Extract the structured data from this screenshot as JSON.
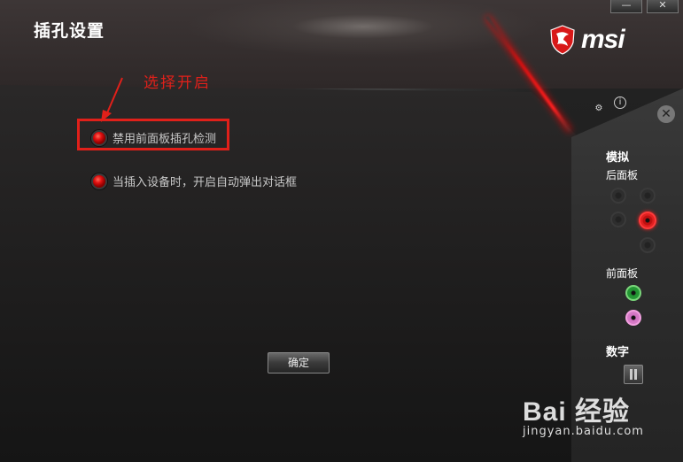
{
  "window": {
    "title": "插孔设置",
    "minimize_label": "—",
    "close_label": "✕"
  },
  "brand": {
    "logo_text": "msi"
  },
  "annotation": {
    "text": "选择开启",
    "color": "#e0201a"
  },
  "options": [
    {
      "label": "禁用前面板插孔检测",
      "selected": true
    },
    {
      "label": "当插入设备时，开启自动弹出对话框",
      "selected": true
    }
  ],
  "ok_button": {
    "label": "确定"
  },
  "side_panel": {
    "settings_icon": "gear-icon",
    "info_icon": "info-icon",
    "close_icon": "close-icon",
    "analog_label": "模拟",
    "rear_label": "后面板",
    "front_label": "前面板",
    "digital_label": "数字"
  },
  "watermark": {
    "main": "Bai  经验",
    "sub": "jingyan.baidu.com"
  },
  "colors": {
    "accent": "#e01010",
    "highlight": "#e0201a"
  }
}
